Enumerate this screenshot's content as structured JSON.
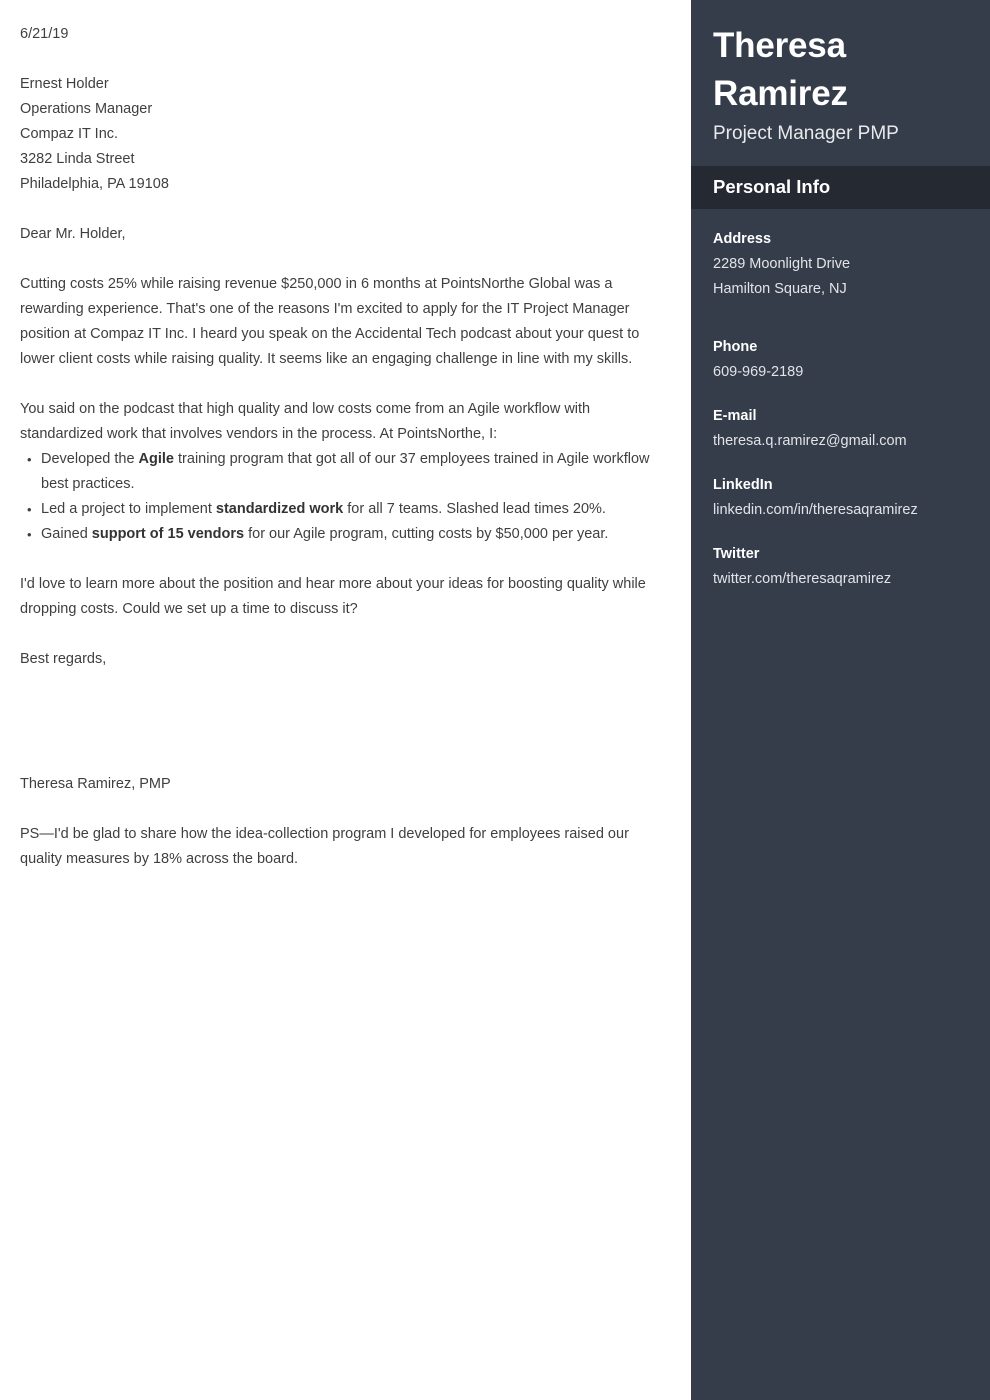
{
  "letter": {
    "date": "6/21/19",
    "recipient": [
      "Ernest Holder",
      "Operations Manager",
      "Compaz IT Inc.",
      "3282 Linda Street",
      "Philadelphia, PA 19108"
    ],
    "salutation": "Dear Mr. Holder,",
    "paragraph_1": "Cutting costs 25% while raising revenue $250,000 in 6 months at PointsNorthe Global was a rewarding experience. That's one of the reasons I'm excited to apply for the IT Project Manager position at Compaz IT Inc. I heard you speak on the Accidental Tech podcast about your quest to lower client costs while raising quality. It seems like an engaging challenge in line with my skills.",
    "paragraph_2": "You said on the podcast that high quality and low costs come from an Agile workflow with standardized work that involves vendors in the process. At PointsNorthe, I:",
    "bullets": [
      {
        "before": "Developed the ",
        "bold": "Agile",
        "after": " training program that got all of our 37 employees trained in Agile workflow best practices."
      },
      {
        "before": "Led a project to implement ",
        "bold": "standardized work",
        "after": " for all 7 teams. Slashed lead times 20%."
      },
      {
        "before": "Gained ",
        "bold": "support of 15 vendors",
        "after": " for our Agile program, cutting costs by $50,000 per year."
      }
    ],
    "paragraph_3": "I'd love to learn more about the position and hear more about your ideas for boosting quality while dropping costs. Could we set up a time to discuss it?",
    "closing": "Best regards,",
    "signature_name": "Theresa Ramirez, PMP",
    "postscript": "PS—I'd be glad to share how the idea-collection program I developed for employees raised our quality measures by 18% across the board."
  },
  "sidebar": {
    "name": "Theresa Ramirez",
    "job_title": "Project Manager PMP",
    "section_label": "Personal Info",
    "contacts": [
      {
        "label": "Address",
        "line1": "2289 Moonlight Drive",
        "line2": "Hamilton Square, NJ"
      },
      {
        "label": "Phone",
        "line1": "609-969-2189"
      },
      {
        "label": "E-mail",
        "line1": "theresa.q.ramirez@gmail.com"
      },
      {
        "label": "LinkedIn",
        "line1": "linkedin.com/in/theresaqramirez"
      },
      {
        "label": "Twitter",
        "line1": "twitter.com/theresaqramirez"
      }
    ]
  },
  "colors": {
    "sidebar_background": "#353c4a",
    "section_band_background": "#252932",
    "body_text": "#3f3f3f",
    "page_background": "#ffffff"
  }
}
